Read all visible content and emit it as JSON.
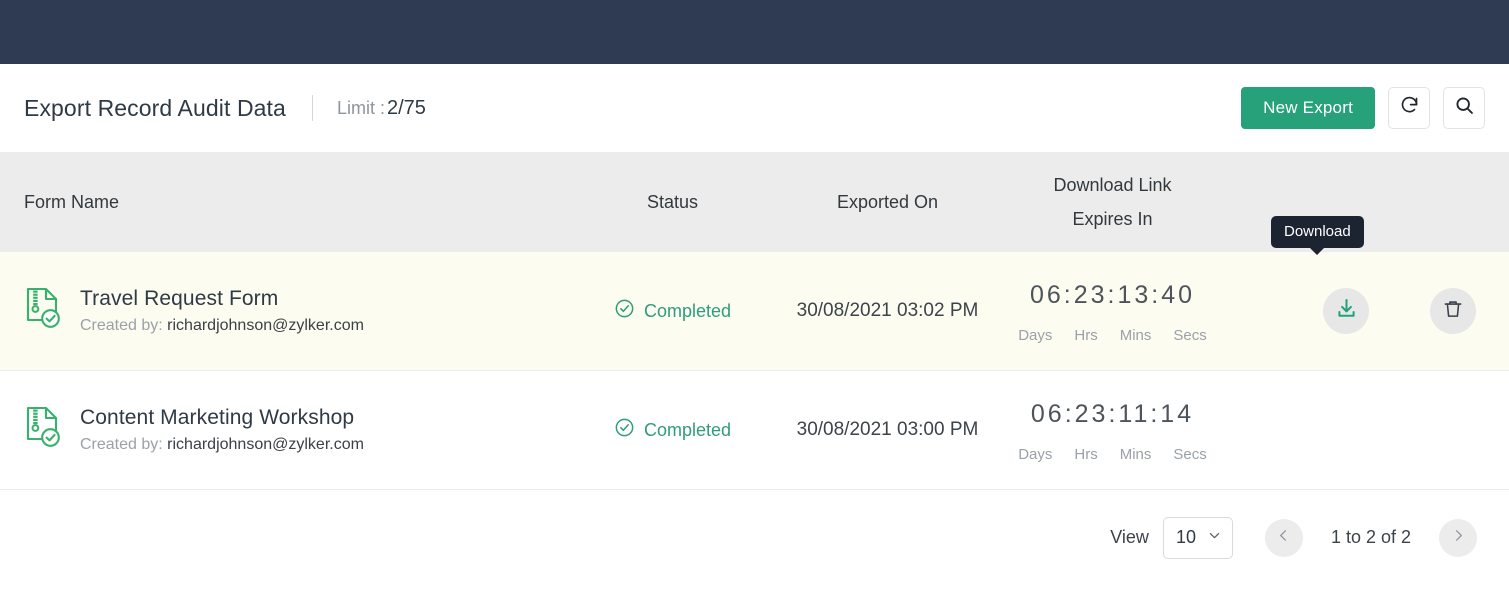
{
  "header": {
    "title": "Export Record Audit Data",
    "limit_label": "Limit :",
    "limit_value": "2/75",
    "new_export_label": "New Export",
    "refresh_icon": "refresh-icon",
    "search_icon": "search-icon"
  },
  "table": {
    "columns": {
      "form_name": "Form Name",
      "status": "Status",
      "exported_on": "Exported On",
      "download_link": "Download Link",
      "expires_in": "Expires In"
    },
    "rows": [
      {
        "file_icon": "zip-file-verified-icon",
        "form_name": "Travel Request Form",
        "created_by_label": "Created by:",
        "created_by_email": "richardjohnson@zylker.com",
        "status": "Completed",
        "status_icon": "check-circle-icon",
        "exported_on": "30/08/2021 03:02 PM",
        "countdown": "06:23:13:40",
        "countdown_labels": [
          "Days",
          "Hrs",
          "Mins",
          "Secs"
        ],
        "has_actions": true,
        "download_icon": "download-icon",
        "delete_icon": "trash-icon",
        "tooltip": "Download",
        "highlighted": true
      },
      {
        "file_icon": "zip-file-verified-icon",
        "form_name": "Content Marketing Workshop",
        "created_by_label": "Created by:",
        "created_by_email": "richardjohnson@zylker.com",
        "status": "Completed",
        "status_icon": "check-circle-icon",
        "exported_on": "30/08/2021 03:00 PM",
        "countdown": "06:23:11:14",
        "countdown_labels": [
          "Days",
          "Hrs",
          "Mins",
          "Secs"
        ],
        "has_actions": false,
        "highlighted": false
      }
    ]
  },
  "footer": {
    "view_label": "View",
    "page_size": "10",
    "range_text": "1 to 2 of 2",
    "prev_icon": "chevron-left-icon",
    "next_icon": "chevron-right-icon",
    "chevron_down_icon": "chevron-down-icon"
  },
  "colors": {
    "topbar": "#2f3a53",
    "accent_green": "#26a179",
    "status_green": "#2e9d7b",
    "row_highlight": "#fdfcf0",
    "header_band": "#ececec",
    "tooltip_bg": "#1c2331"
  }
}
